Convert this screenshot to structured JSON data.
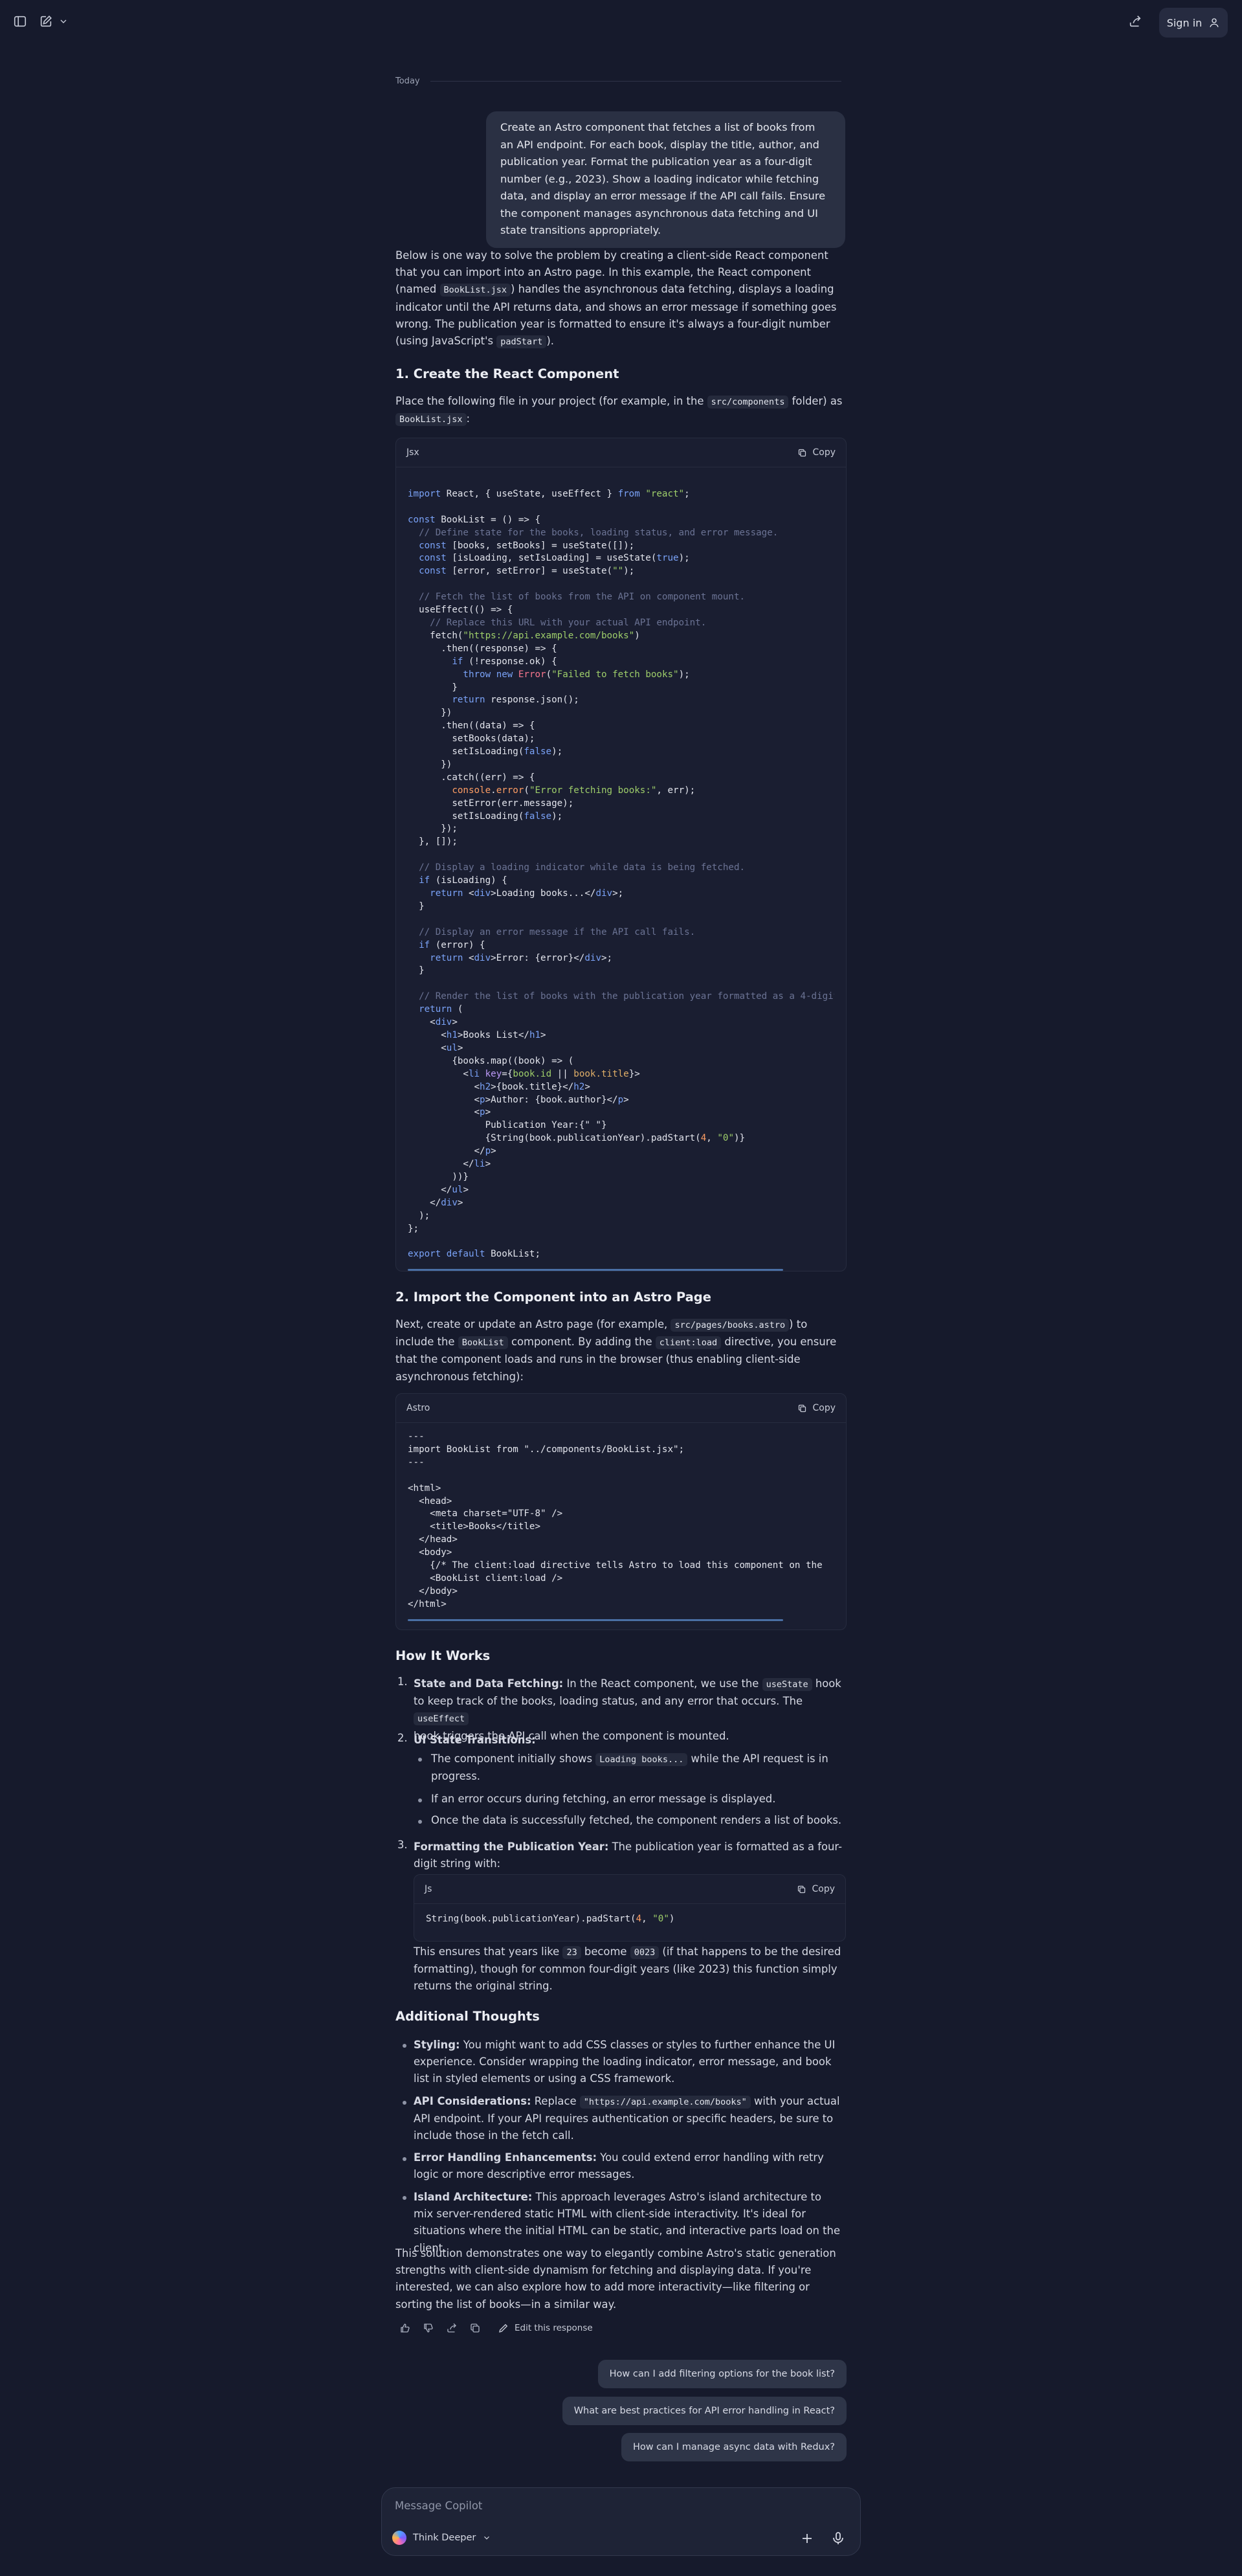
{
  "header": {
    "sign_in_label": "Sign in"
  },
  "conversation": {
    "date_label": "Today",
    "user_message": "Create an Astro component that fetches a list of books from an API endpoint. For each book, display the title, author, and publication year. Format the publication year as a four-digit number (e.g., 2023). Show a loading indicator while fetching data, and display an error message if the API call fails. Ensure the component manages asynchronous data fetching and UI state transitions appropriately."
  },
  "response": {
    "intro_part1": "Below is one way to solve the problem by creating a client-side React component that you can import into an Astro page. In this example, the React component (named ",
    "intro_code1": "BookList.jsx",
    "intro_part2": ") handles the asynchronous data fetching, displays a loading indicator until the API returns data, and shows an error message if something goes wrong. The publication year is formatted to ensure it's always a four-digit number (using JavaScript's ",
    "intro_code2": "padStart",
    "intro_part3": ").",
    "section1_title": "1. Create the React Component",
    "section1_p1": "Place the following file in your project (for example, in the ",
    "section1_code1": "src/components",
    "section1_p2": " folder) as",
    "section1_code2": "BookList.jsx",
    "section1_p3": ":",
    "code1_lang": "Jsx",
    "copy_label": "Copy",
    "section2_title": "2. Import the Component into an Astro Page",
    "section2_p1": "Next, create or update an Astro page (for example, ",
    "section2_code1": "src/pages/books.astro",
    "section2_p2": ") to include the ",
    "section2_code2": "BookList",
    "section2_p3": " component. By adding the ",
    "section2_code3": "client:load",
    "section2_p4": " directive, you ensure that the component loads and runs in the browser (thus enabling client-side asynchronous fetching):",
    "code2_lang": "Astro",
    "how_title": "How It Works",
    "how1_num": "1.",
    "how1_bold": "State and Data Fetching:",
    "how1_p1": " In the React component, we use the ",
    "how1_code1": "useState",
    "how1_p2": " hook to keep track of the books, loading status, and any error that occurs. The ",
    "how1_code2": "useEffect",
    "how1_p3": "hook triggers the API call when the component is mounted.",
    "how2_num": "2.",
    "how2_bold": "UI State Transitions:",
    "how2_b1_p1": "The component initially shows ",
    "how2_b1_code": "Loading books...",
    "how2_b1_p2": " while the API request is in progress.",
    "how2_b2": "If an error occurs during fetching, an error message is displayed.",
    "how2_b3": "Once the data is successfully fetched, the component renders a list of books.",
    "how3_num": "3.",
    "how3_bold": "Formatting the Publication Year:",
    "how3_p1": " The publication year is formatted as a four-digit string with:",
    "code3_lang": "Js",
    "how3_after_p1": "This ensures that years like ",
    "how3_after_code1": "23",
    "how3_after_p2": " become ",
    "how3_after_code2": "0023",
    "how3_after_p3": " (if that happens to be the desired formatting), though for common four-digit years (like 2023) this function simply returns the original string.",
    "add_title": "Additional Thoughts",
    "add1_bold": "Styling:",
    "add1_text": " You might want to add CSS classes or styles to further enhance the UI experience. Consider wrapping the loading indicator, error message, and book list in styled elements or using a CSS framework.",
    "add2_bold": "API Considerations:",
    "add2_p1": " Replace ",
    "add2_code": "\"https://api.example.com/books\"",
    "add2_p2": " with your actual API endpoint. If your API requires authentication or specific headers, be sure to include those in the fetch call.",
    "add3_bold": "Error Handling Enhancements:",
    "add3_text": " You could extend error handling with retry logic or more descriptive error messages.",
    "add4_bold": "Island Architecture:",
    "add4_text": " This approach leverages Astro's island architecture to mix server-rendered static HTML with client-side interactivity. It's ideal for situations where the initial HTML can be static, and interactive parts load on the client.",
    "closing": "This solution demonstrates one way to elegantly combine Astro's static generation strengths with client-side dynamism for fetching and displaying data. If you're interested, we can also explore how to add more interactivity—like filtering or sorting the list of books—in a similar way.",
    "edit_label": "Edit this response"
  },
  "suggestions": [
    "How can I add filtering options for the book list?",
    "What are best practices for API error handling in React?",
    "How can I manage async data with Redux?"
  ],
  "composer": {
    "placeholder": "Message Copilot",
    "mode_label": "Think Deeper"
  }
}
